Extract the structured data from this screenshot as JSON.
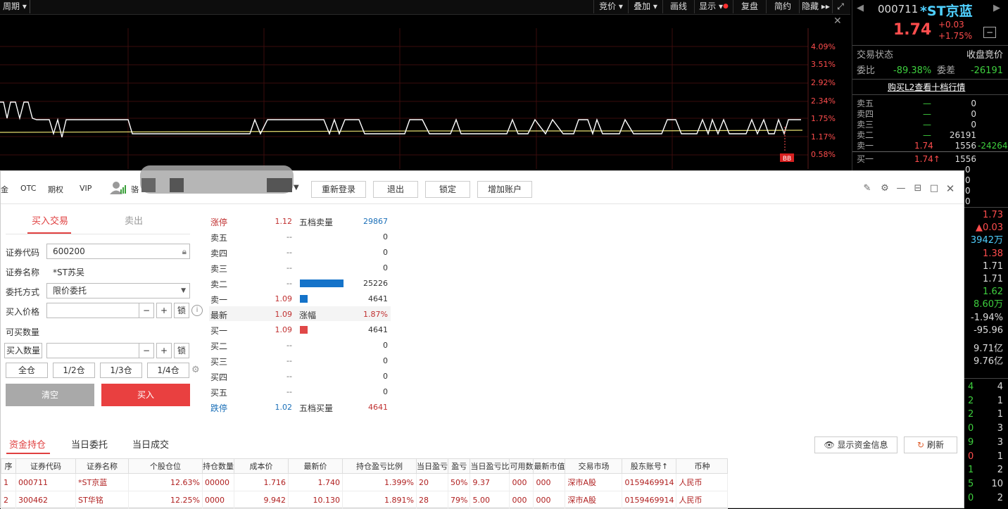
{
  "toolbar": {
    "period": "周期",
    "items": [
      "竞价",
      "叠加",
      "画线",
      "显示",
      "复盘",
      "简约",
      "隐藏"
    ]
  },
  "chart": {
    "percent_labels": [
      "4.09%",
      "3.51%",
      "2.92%",
      "2.34%",
      "1.75%",
      "1.17%",
      "0.58%"
    ],
    "badge": "BB"
  },
  "quote": {
    "code": "000711",
    "name": "*ST京蓝",
    "price": "1.74",
    "change": "+0.03",
    "change_pct": "+1.75%",
    "status_label": "交易状态",
    "status_value": "收盘竞价",
    "weibi_label": "委比",
    "weibi_value": "-89.38%",
    "weicha_label": "委差",
    "weicha_value": "-26191",
    "l2_link": "购买L2查看十档行情",
    "asks": [
      {
        "label": "卖五",
        "price": "—",
        "vol": "0"
      },
      {
        "label": "卖四",
        "price": "—",
        "vol": "0"
      },
      {
        "label": "卖三",
        "price": "—",
        "vol": "0"
      },
      {
        "label": "卖二",
        "price": "—",
        "vol": "26191"
      },
      {
        "label": "卖一",
        "price": "1.74",
        "vol": "1556",
        "extra": "-24264"
      }
    ],
    "bid1": {
      "label": "买一",
      "price": "1.74↑",
      "vol": "1556"
    },
    "bid_zeros": [
      "0",
      "0",
      "0",
      "0"
    ],
    "stats": [
      "1.73",
      "▲0.03",
      "3942万",
      "1.38",
      "1.71",
      "1.71",
      "1.62",
      "8.60万",
      "-1.94%",
      "-95.96",
      "9.71亿",
      "9.76亿"
    ],
    "trades": [
      [
        "4",
        "4"
      ],
      [
        "2",
        "1"
      ],
      [
        "2",
        "1"
      ],
      [
        "0",
        "3"
      ],
      [
        "9",
        "3"
      ],
      [
        "0",
        "1"
      ],
      [
        "1",
        "2"
      ],
      [
        "5",
        "10"
      ],
      [
        "0",
        "2"
      ]
    ]
  },
  "dialog": {
    "tabs": [
      "金",
      "OTC",
      "期权",
      "VIP"
    ],
    "user_prefix": "骆",
    "buttons": [
      "重新登录",
      "退出",
      "锁定",
      "增加账户"
    ],
    "buy_tab": "买入交易",
    "sell_tab": "卖出",
    "code_label": "证券代码",
    "code_value": "600200",
    "name_label": "证券名称",
    "name_value": "*ST苏吴",
    "order_type_label": "委托方式",
    "order_type_value": "限价委托",
    "price_label": "买入价格",
    "avail_label": "可买数量",
    "qty_label": "买入数量",
    "minus": "−",
    "plus": "+",
    "lock": "锁",
    "positions": [
      "全仓",
      "1/2仓",
      "1/3仓",
      "1/4仓"
    ],
    "clear": "清空",
    "buy": "买入",
    "orderbook": [
      {
        "name": "涨停",
        "price": "1.12",
        "label2": "五档卖量",
        "vol": "29867",
        "name_color": "#c03030",
        "price_color": "#c03030",
        "vol_color": "#1a6fb8"
      },
      {
        "name": "卖五",
        "price": "--",
        "vol": "0"
      },
      {
        "name": "卖四",
        "price": "--",
        "vol": "0"
      },
      {
        "name": "卖三",
        "price": "--",
        "vol": "0"
      },
      {
        "name": "卖二",
        "price": "--",
        "vol": "25226",
        "bar": 62,
        "bar_color": "#1573c9"
      },
      {
        "name": "卖一",
        "price": "1.09",
        "vol": "4641",
        "bar": 11,
        "bar_color": "#1573c9",
        "price_color": "#c03030"
      },
      {
        "name": "最新",
        "price": "1.09",
        "label2": "涨幅",
        "vol": "1.87%",
        "price_color": "#c03030",
        "vol_color": "#c03030"
      },
      {
        "name": "买一",
        "price": "1.09",
        "vol": "4641",
        "bar": 11,
        "bar_color": "#e04848",
        "price_color": "#c03030"
      },
      {
        "name": "买二",
        "price": "--",
        "vol": "0"
      },
      {
        "name": "买三",
        "price": "--",
        "vol": "0"
      },
      {
        "name": "买四",
        "price": "--",
        "vol": "0"
      },
      {
        "name": "买五",
        "price": "--",
        "vol": "0"
      },
      {
        "name": "跌停",
        "price": "1.02",
        "label2": "五档买量",
        "vol": "4641",
        "name_color": "#1a6fb8",
        "price_color": "#1a6fb8",
        "vol_color": "#c03030"
      }
    ],
    "bottom_tabs": [
      "资金持仓",
      "当日委托",
      "当日成交"
    ],
    "show_funds": "显示资金信息",
    "refresh": "刷新",
    "table": {
      "headers": [
        "序",
        "证券代码",
        "证券名称",
        "个股仓位",
        "持仓数量",
        "成本价",
        "最新价",
        "持仓盈亏比例",
        "当日盈亏",
        "盈亏",
        "当日盈亏比",
        "可用数",
        "最新市值",
        "交易市场",
        "股东账号↑",
        "币种"
      ],
      "rows": [
        [
          "1",
          "000711",
          "*ST京蓝",
          "12.63%",
          "00000",
          "1.716",
          "1.740",
          "1.399%",
          "20",
          "50%",
          "9.37",
          "000",
          "000",
          "深市A股",
          "0159469914",
          "人民币"
        ],
        [
          "2",
          "300462",
          "ST华铭",
          "12.25%",
          "0000",
          "9.942",
          "10.130",
          "1.891%",
          "28",
          "79%",
          "5.00",
          "000",
          "000",
          "深市A股",
          "0159469914",
          "人民币"
        ]
      ]
    }
  }
}
